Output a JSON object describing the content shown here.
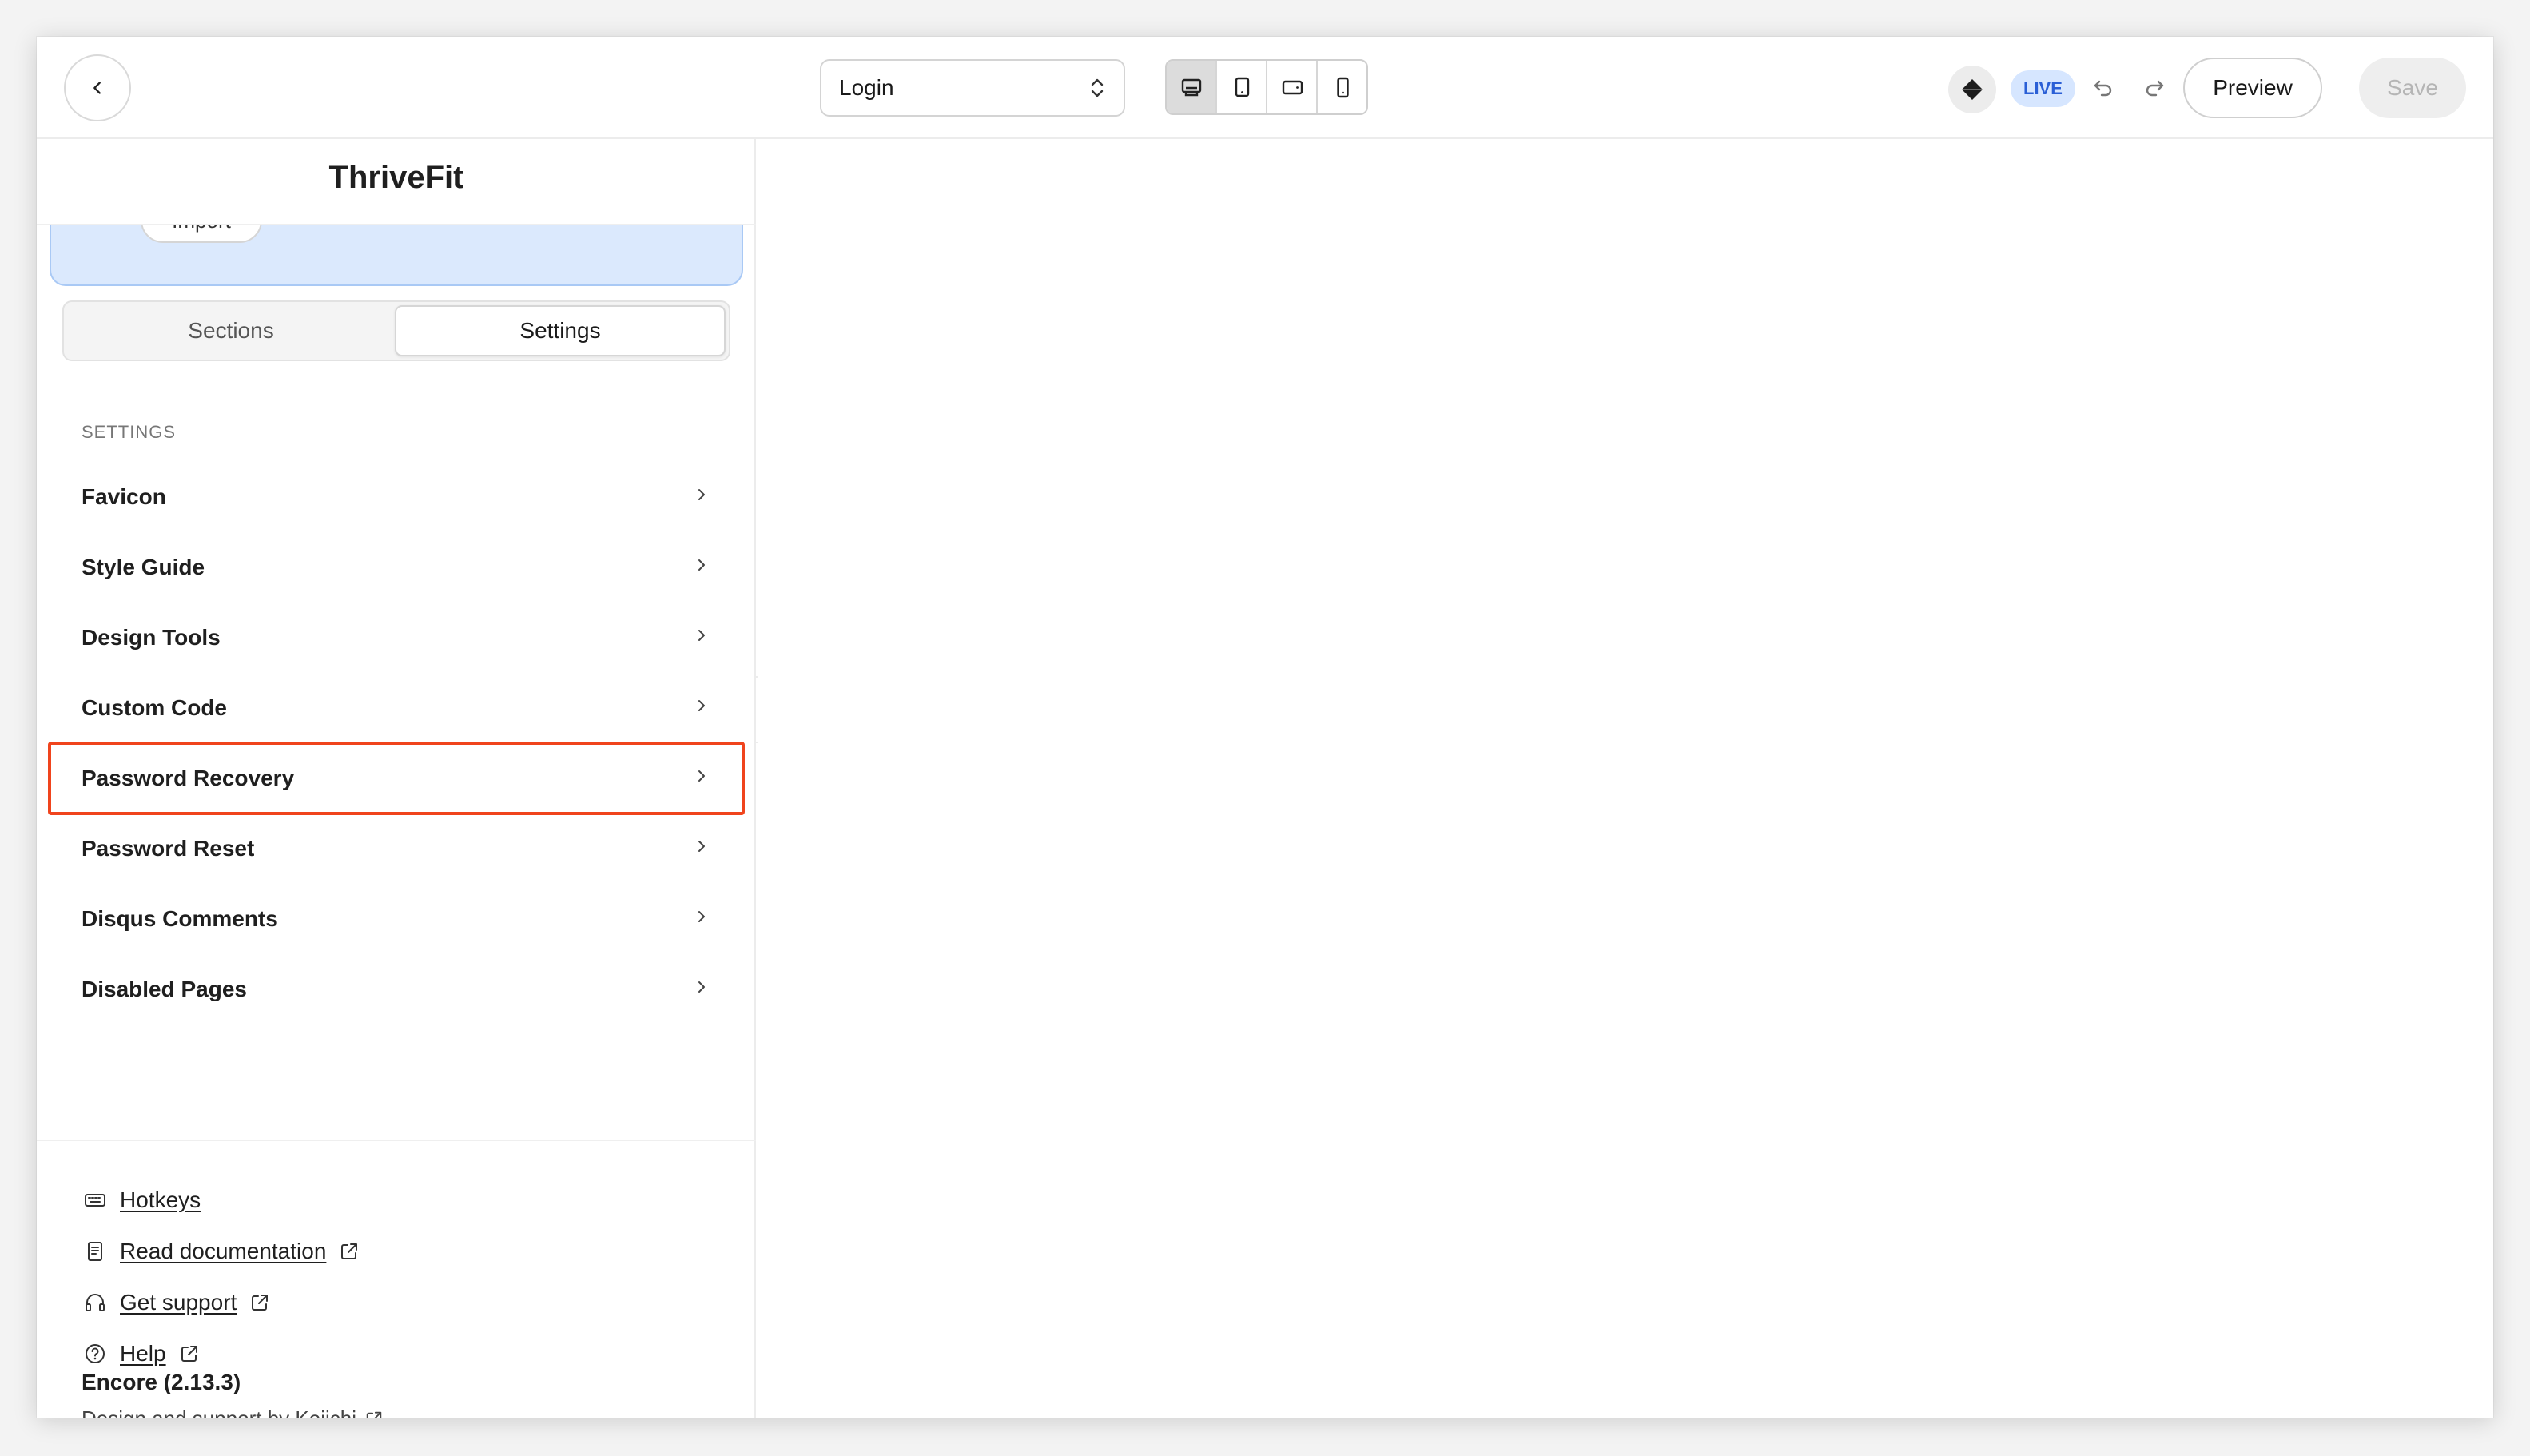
{
  "topbar": {
    "page_selector": {
      "value": "Login"
    },
    "device_modes": [
      {
        "name": "desktop",
        "active": true
      },
      {
        "name": "tablet-portrait",
        "active": false
      },
      {
        "name": "tablet-landscape",
        "active": false
      },
      {
        "name": "mobile",
        "active": false
      }
    ],
    "live_badge": "LIVE",
    "preview_label": "Preview",
    "save_label": "Save"
  },
  "sidebar": {
    "brand": "ThriveFit",
    "import_label": "Import",
    "tabs": [
      {
        "label": "Sections",
        "active": false
      },
      {
        "label": "Settings",
        "active": true
      }
    ],
    "section_label": "SETTINGS",
    "items": [
      {
        "label": "Favicon"
      },
      {
        "label": "Style Guide"
      },
      {
        "label": "Design Tools"
      },
      {
        "label": "Custom Code"
      },
      {
        "label": "Password Recovery",
        "highlighted": true
      },
      {
        "label": "Password Reset"
      },
      {
        "label": "Disqus Comments"
      },
      {
        "label": "Disabled Pages"
      }
    ],
    "footer_links": [
      {
        "label": "Hotkeys",
        "icon": "keyboard-icon",
        "external": false
      },
      {
        "label": "Read documentation",
        "icon": "document-icon",
        "external": true
      },
      {
        "label": "Get support",
        "icon": "headset-icon",
        "external": true
      },
      {
        "label": "Help",
        "icon": "question-circle-icon",
        "external": true
      }
    ],
    "version": "Encore (2.13.3)",
    "credits": "Design and support by Keiichi"
  },
  "colors": {
    "highlight_outline": "#f0441d",
    "live_badge_bg": "#d6e6ff",
    "live_badge_text": "#2a5fd6",
    "import_banner_bg": "#dbe9fd"
  }
}
